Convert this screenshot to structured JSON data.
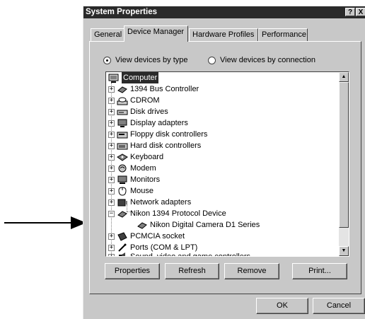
{
  "window": {
    "title": "System Properties",
    "help_label": "?",
    "close_label": "X"
  },
  "tabs": [
    {
      "label": "General",
      "active": false
    },
    {
      "label": "Device Manager",
      "active": true
    },
    {
      "label": "Hardware Profiles",
      "active": false
    },
    {
      "label": "Performance",
      "active": false
    }
  ],
  "view_options": {
    "by_type": {
      "label": "View devices by type",
      "selected": true
    },
    "by_connection": {
      "label": "View devices by connection",
      "selected": false
    }
  },
  "tree": {
    "root": "Computer",
    "items": [
      {
        "label": "1394 Bus Controller",
        "expanded": false,
        "icon": "bus-controller-icon"
      },
      {
        "label": "CDROM",
        "expanded": false,
        "icon": "cdrom-icon"
      },
      {
        "label": "Disk drives",
        "expanded": false,
        "icon": "disk-drive-icon"
      },
      {
        "label": "Display adapters",
        "expanded": false,
        "icon": "display-adapter-icon"
      },
      {
        "label": "Floppy disk controllers",
        "expanded": false,
        "icon": "floppy-controller-icon"
      },
      {
        "label": "Hard disk controllers",
        "expanded": false,
        "icon": "hard-disk-controller-icon"
      },
      {
        "label": "Keyboard",
        "expanded": false,
        "icon": "keyboard-icon"
      },
      {
        "label": "Modem",
        "expanded": false,
        "icon": "modem-icon"
      },
      {
        "label": "Monitors",
        "expanded": false,
        "icon": "monitor-icon"
      },
      {
        "label": "Mouse",
        "expanded": false,
        "icon": "mouse-icon"
      },
      {
        "label": "Network adapters",
        "expanded": false,
        "icon": "network-adapter-icon"
      },
      {
        "label": "Nikon 1394 Protocol Device",
        "expanded": true,
        "icon": "protocol-device-icon"
      },
      {
        "label": "PCMCIA socket",
        "expanded": false,
        "icon": "pcmcia-icon"
      },
      {
        "label": "Ports (COM & LPT)",
        "expanded": false,
        "icon": "port-icon"
      },
      {
        "label": "Sound, video and game controllers",
        "expanded": false,
        "icon": "sound-icon"
      }
    ],
    "child": "Nikon Digital Camera D1 Series"
  },
  "buttons": {
    "properties": "Properties",
    "refresh": "Refresh",
    "remove": "Remove",
    "print": "Print...",
    "ok": "OK",
    "cancel": "Cancel"
  }
}
